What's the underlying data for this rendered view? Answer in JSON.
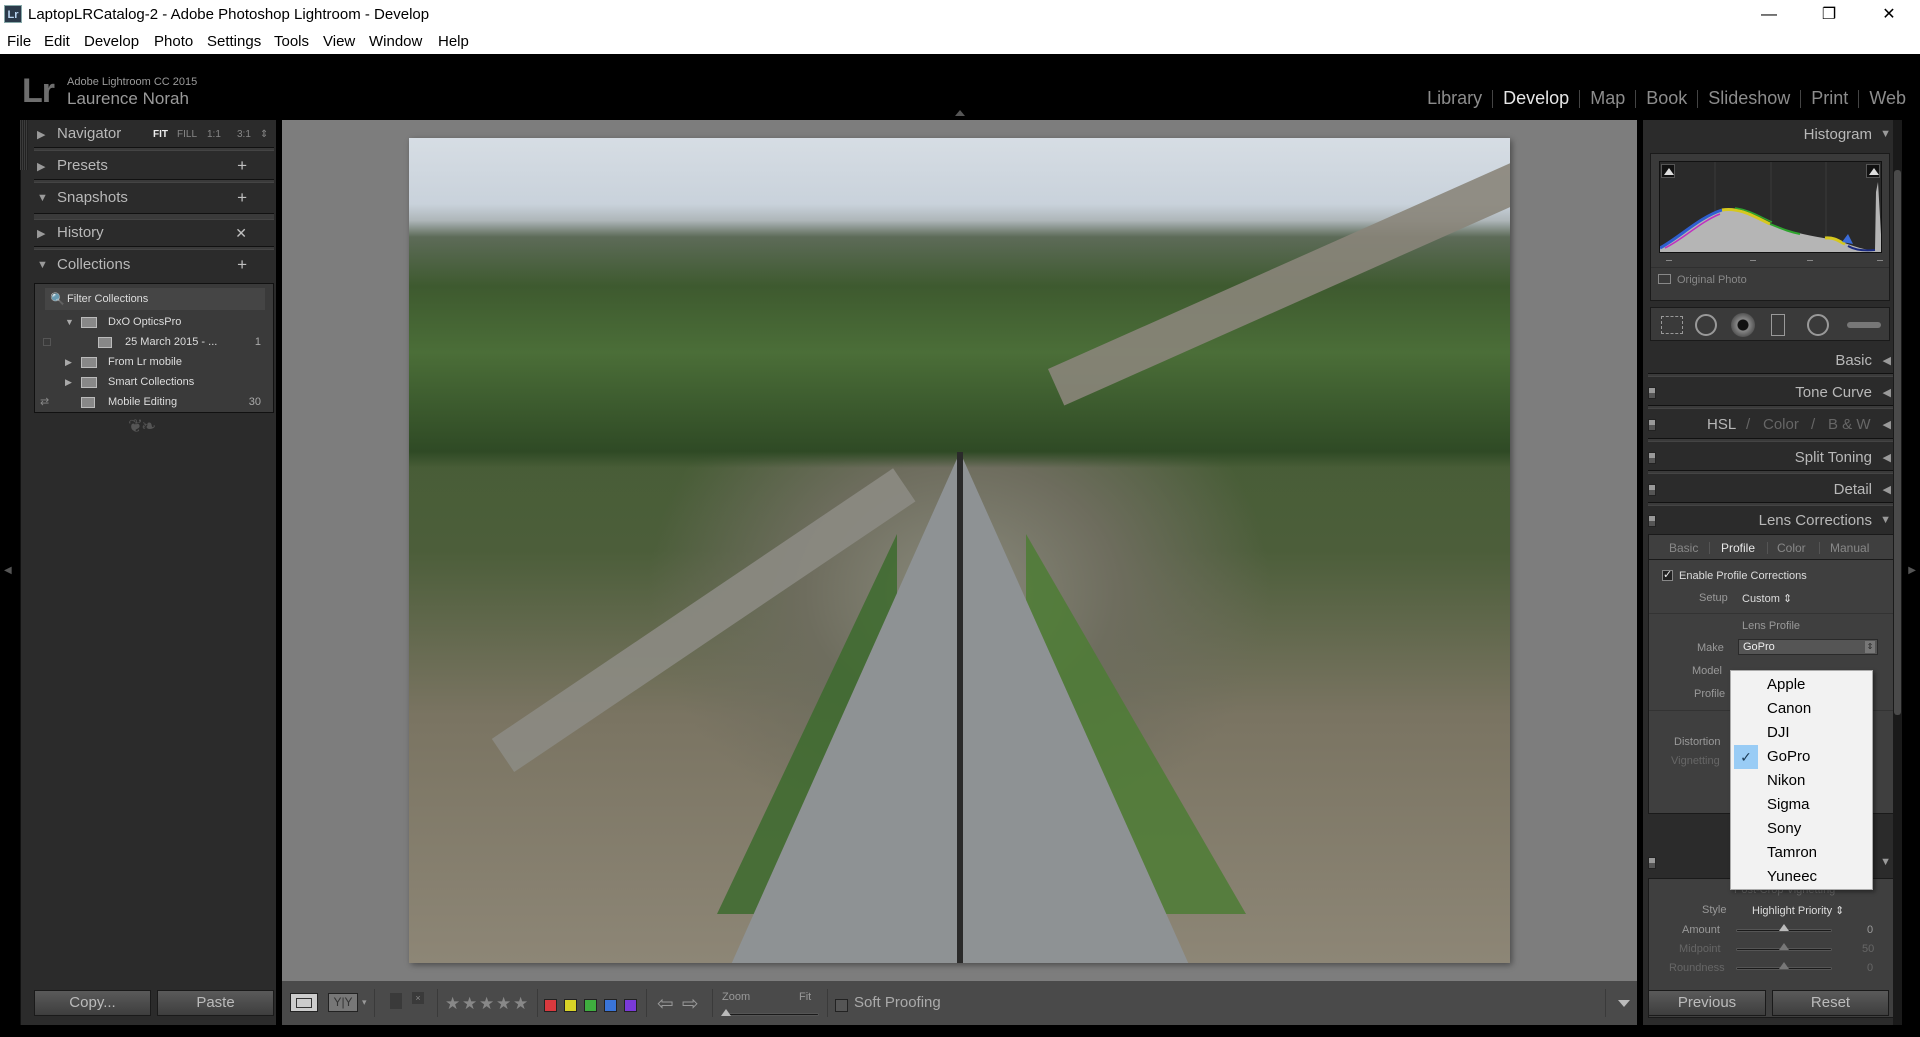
{
  "window": {
    "title": "LaptopLRCatalog-2 - Adobe Photoshop Lightroom - Develop",
    "app_icon": "Lr",
    "controls": {
      "minimize": "—",
      "restore": "❐",
      "close": "✕"
    }
  },
  "menu": [
    "File",
    "Edit",
    "Develop",
    "Photo",
    "Settings",
    "Tools",
    "View",
    "Window",
    "Help"
  ],
  "identity": {
    "logo": "Lr",
    "product": "Adobe Lightroom CC 2015",
    "user": "Laurence Norah"
  },
  "modules": [
    {
      "label": "Library",
      "active": false
    },
    {
      "label": "Develop",
      "active": true
    },
    {
      "label": "Map",
      "active": false
    },
    {
      "label": "Book",
      "active": false
    },
    {
      "label": "Slideshow",
      "active": false
    },
    {
      "label": "Print",
      "active": false
    },
    {
      "label": "Web",
      "active": false
    }
  ],
  "left_panel": {
    "navigator": {
      "label": "Navigator",
      "zoom_options": [
        "FIT",
        "FILL",
        "1:1",
        "3:1"
      ],
      "active_zoom": "FIT",
      "collapsed": true
    },
    "presets": {
      "label": "Presets",
      "action": "+",
      "collapsed": true
    },
    "snapshots": {
      "label": "Snapshots",
      "action": "+",
      "collapsed": false
    },
    "history": {
      "label": "History",
      "action": "✕",
      "collapsed": true
    },
    "collections": {
      "label": "Collections",
      "action": "+",
      "filter_placeholder": "Filter Collections",
      "items": [
        {
          "name": "DxO OpticsPro",
          "type": "set",
          "expanded": true,
          "count": ""
        },
        {
          "name": "25 March 2015 - ...",
          "type": "collection",
          "count": "1"
        },
        {
          "name": "From Lr mobile",
          "type": "set",
          "expanded": false,
          "count": ""
        },
        {
          "name": "Smart Collections",
          "type": "set",
          "expanded": false,
          "count": ""
        },
        {
          "name": "Mobile Editing",
          "type": "collection",
          "count": "30",
          "synced": true
        }
      ]
    },
    "copy_label": "Copy...",
    "paste_label": "Paste"
  },
  "right_panel": {
    "histogram": {
      "label": "Histogram",
      "original_photo_label": "Original Photo"
    },
    "tools": [
      "crop-overlay",
      "spot-removal",
      "red-eye",
      "graduated-filter",
      "radial-filter",
      "adjustment-brush"
    ],
    "sections": [
      {
        "label": "Basic"
      },
      {
        "label": "Tone Curve"
      },
      {
        "label": "HSL",
        "extra": [
          "Color",
          "B & W"
        ]
      },
      {
        "label": "Split Toning"
      },
      {
        "label": "Detail"
      },
      {
        "label": "Lens Corrections",
        "expanded": true
      }
    ],
    "lens_corrections": {
      "tabs": [
        {
          "label": "Basic",
          "active": false
        },
        {
          "label": "Profile",
          "active": true
        },
        {
          "label": "Color",
          "active": false
        },
        {
          "label": "Manual",
          "active": false
        }
      ],
      "enable_label": "Enable Profile Corrections",
      "enable_checked": true,
      "setup_label": "Setup",
      "setup_value": "Custom",
      "lens_profile_title": "Lens Profile",
      "make_label": "Make",
      "make_value": "GoPro",
      "model_label": "Model",
      "profile_label": "Profile",
      "distortion_label": "Distortion",
      "vignetting_label": "Vignetting"
    },
    "make_dropdown": {
      "options": [
        "Apple",
        "Canon",
        "DJI",
        "GoPro",
        "Nikon",
        "Sigma",
        "Sony",
        "Tamron",
        "Yuneec"
      ],
      "selected": "GoPro"
    },
    "effects": {
      "title": "Post-Crop Vignetting",
      "style_label": "Style",
      "style_value": "Highlight Priority",
      "sliders": [
        {
          "label": "Amount",
          "value": "0",
          "position": 0.5
        },
        {
          "label": "Midpoint",
          "value": "50",
          "position": 0.5
        },
        {
          "label": "Roundness",
          "value": "0",
          "position": 0.5
        }
      ]
    },
    "previous_label": "Previous",
    "reset_label": "Reset"
  },
  "toolbar": {
    "flags": [
      "flag",
      "reject"
    ],
    "stars": 5,
    "color_labels": [
      {
        "name": "red",
        "color": "#d9393e"
      },
      {
        "name": "yellow",
        "color": "#d8d327"
      },
      {
        "name": "green",
        "color": "#3fad3f"
      },
      {
        "name": "blue",
        "color": "#3a74d8"
      },
      {
        "name": "purple",
        "color": "#7a3ad8"
      }
    ],
    "zoom_label": "Zoom",
    "zoom_value_label": "Fit",
    "soft_proofing_label": "Soft Proofing",
    "soft_proofing_checked": false
  },
  "colors": {
    "panel_bg": "#2b2b2b",
    "canvas_bg": "#7d7d7d",
    "active_text": "#e6e6e6",
    "dropdown_highlight": "#99ccf5"
  }
}
